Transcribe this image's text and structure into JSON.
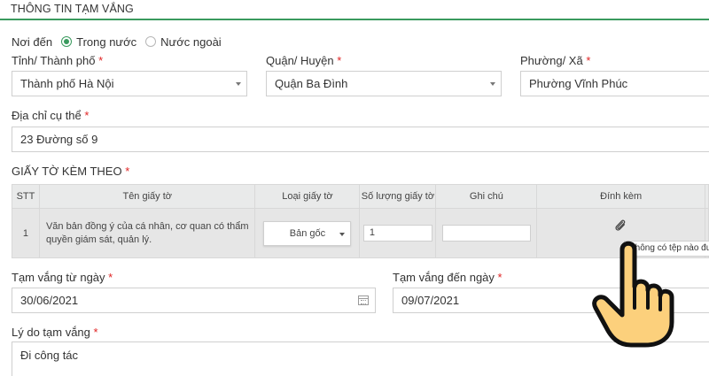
{
  "section": {
    "title": "THÔNG TIN TẠM VẮNG"
  },
  "destination": {
    "label": "Nơi đến",
    "options": [
      {
        "label": "Trong nước",
        "selected": true
      },
      {
        "label": "Nước ngoài",
        "selected": false
      }
    ]
  },
  "address": {
    "province": {
      "label": "Tỉnh/ Thành phố",
      "value": "Thành phố Hà Nội"
    },
    "district": {
      "label": "Quận/ Huyện",
      "value": "Quận Ba Đình"
    },
    "ward": {
      "label": "Phường/ Xã",
      "value": "Phường Vĩnh Phúc"
    },
    "detail": {
      "label": "Địa chỉ cụ thể",
      "value": "23 Đường số 9"
    },
    "required_mark": "*"
  },
  "documents": {
    "title": "GIẤY TỜ KÈM THEO",
    "columns": [
      "STT",
      "Tên giấy tờ",
      "Loại giấy tờ",
      "Số lượng giấy tờ",
      "Ghi chú",
      "Đính kèm"
    ],
    "rows": [
      {
        "stt": "1",
        "name": "Văn bản đồng ý của cá nhân, cơ quan có thẩm quyền giám sát, quản lý.",
        "type": "Bản gốc",
        "quantity": "1",
        "note": "",
        "attachment_tooltip": "Không có tệp nào được"
      }
    ]
  },
  "period": {
    "from": {
      "label": "Tạm vắng từ ngày",
      "value": "30/06/2021"
    },
    "to": {
      "label": "Tạm vắng đến ngày",
      "value": "09/07/2021"
    }
  },
  "reason": {
    "label": "Lý do tạm vắng",
    "value": "Đi công tác"
  },
  "colors": {
    "accent": "#3a9a5e",
    "required": "#e02424",
    "hand_fill": "#fcd07c"
  }
}
